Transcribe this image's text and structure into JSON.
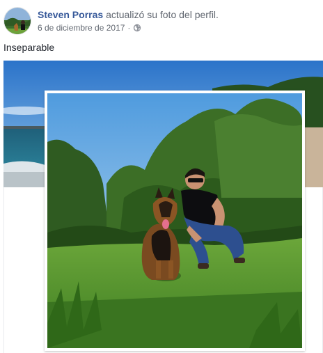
{
  "post": {
    "author_name": "Steven Porras",
    "action_text": "actualizó su foto del perfil.",
    "date": "6 de diciembre de 2017",
    "separator": "·",
    "privacy_icon": "globe-icon",
    "caption": "Inseparable"
  },
  "colors": {
    "author": "#365899",
    "meta": "#616770",
    "text": "#1d2129"
  }
}
